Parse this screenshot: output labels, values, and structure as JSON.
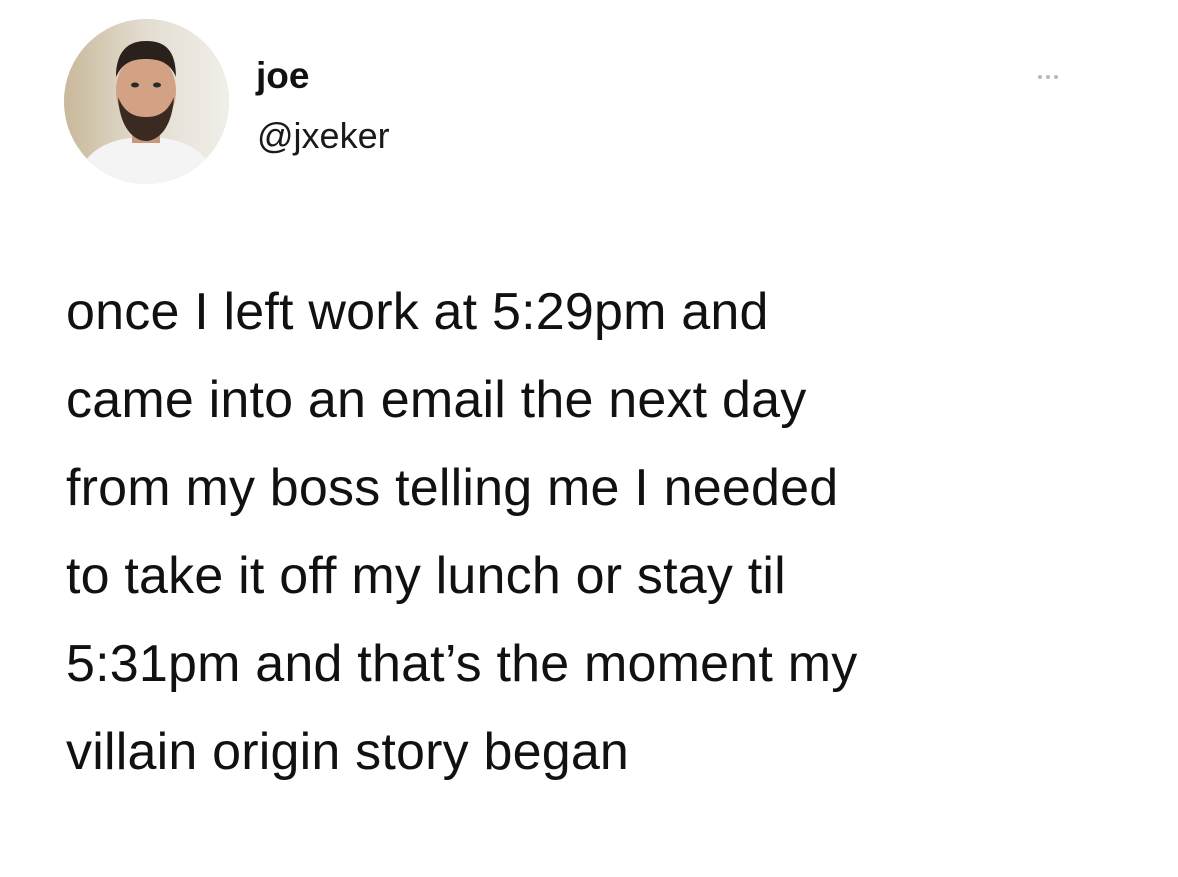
{
  "user": {
    "display_name": "joe",
    "handle": "@jxeker"
  },
  "tweet": {
    "lines": [
      "once I left work at 5:29pm and",
      "came into an email the next day",
      "from my boss telling me I needed",
      "to take it off my lunch or stay til",
      "5:31pm and that’s the moment my",
      "villain origin story began"
    ]
  },
  "icons": {
    "more": "more-horizontal-icon"
  }
}
